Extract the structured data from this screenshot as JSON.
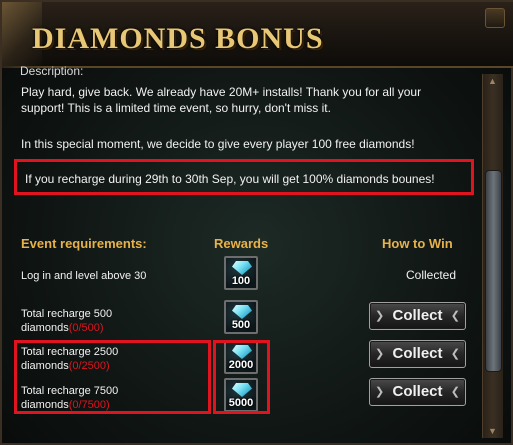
{
  "header": {
    "title": "DIAMONDS BONUS"
  },
  "intro": {
    "cut_line": "Description:",
    "line1": "Play hard, give back. We already have 20M+ installs! Thank you for all your",
    "line2": "support! This is a limited time event, so hurry, don't miss it.",
    "line3": "In this special moment, we decide to give every player 100 free diamonds!",
    "highlight": "If you recharge during 29th to 30th Sep, you will get 100% diamonds bounes!"
  },
  "table": {
    "headers": {
      "requirements": "Event requirements:",
      "rewards": "Rewards",
      "how_to_win": "How to Win"
    },
    "rows": [
      {
        "requirement": "Log in and level above 30",
        "progress": "",
        "reward": "100",
        "status": "Collected"
      },
      {
        "requirement_line1": "Total recharge 500",
        "requirement_line2": "diamonds",
        "progress": "(0/500)",
        "reward": "500",
        "action": "Collect"
      },
      {
        "requirement_line1": "Total recharge 2500",
        "requirement_line2": "diamonds",
        "progress": "(0/2500)",
        "reward": "2000",
        "action": "Collect"
      },
      {
        "requirement_line1": "Total recharge 7500",
        "requirement_line2": "diamonds",
        "progress": "(0/7500)",
        "reward": "5000",
        "action": "Collect"
      }
    ]
  },
  "colors": {
    "accent": "#e8b24a",
    "highlight_border": "#e0141e",
    "progress": "#e0141e"
  },
  "icons": {
    "reward": "diamond-icon",
    "close": "close-icon"
  }
}
